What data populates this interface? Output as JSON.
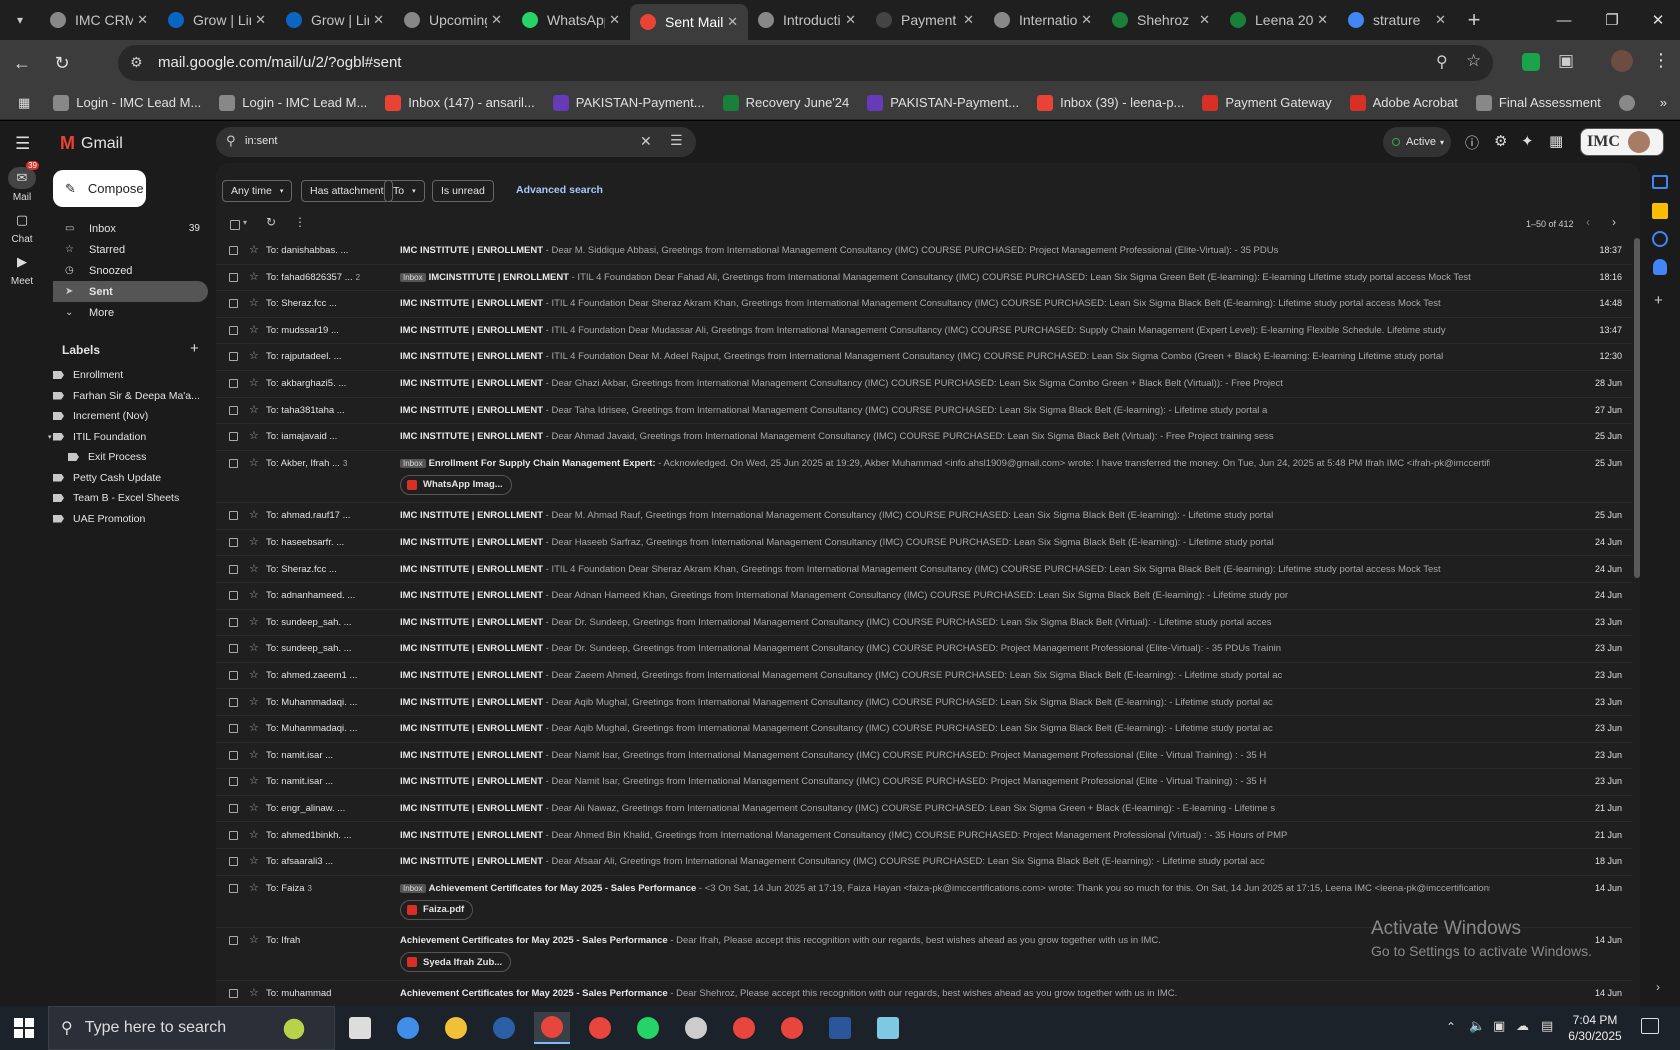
{
  "browser": {
    "tabs": [
      {
        "title": "IMC CRM",
        "favicon_color": "#888888"
      },
      {
        "title": "Grow | LinkedIn",
        "favicon_color": "#0a66c2"
      },
      {
        "title": "Grow | LinkedIn",
        "favicon_color": "#0a66c2"
      },
      {
        "title": "Upcoming",
        "favicon_color": "#888888"
      },
      {
        "title": "WhatsApp",
        "favicon_color": "#25d366"
      },
      {
        "title": "Sent Mail",
        "favicon_color": "#ea4335"
      },
      {
        "title": "Introduction",
        "favicon_color": "#888888"
      },
      {
        "title": "Payment",
        "favicon_color": "#444444"
      },
      {
        "title": "International",
        "favicon_color": "#888888"
      },
      {
        "title": "Shehroz",
        "favicon_color": "#188038"
      },
      {
        "title": "Leena 20",
        "favicon_color": "#188038"
      },
      {
        "title": "strature",
        "favicon_color": "#4285f4"
      }
    ],
    "active_tab": 5,
    "url": "mail.google.com/mail/u/2/?ogbl#sent",
    "bookmarks": [
      {
        "label": "Login - IMC Lead M...",
        "color": "#888888"
      },
      {
        "label": "Login - IMC Lead M...",
        "color": "#888888"
      },
      {
        "label": "Inbox (147) - ansaril...",
        "color": "#ea4335"
      },
      {
        "label": "PAKISTAN-Payment...",
        "color": "#673ab7"
      },
      {
        "label": "Recovery June'24",
        "color": "#188038"
      },
      {
        "label": "PAKISTAN-Payment...",
        "color": "#673ab7"
      },
      {
        "label": "Inbox (39) - leena-p...",
        "color": "#ea4335"
      },
      {
        "label": "Payment Gateway",
        "color": "#d93025"
      },
      {
        "label": "Adobe Acrobat",
        "color": "#d93025"
      },
      {
        "label": "Final Assessment",
        "color": "#888888"
      }
    ]
  },
  "gmail": {
    "logo": "Gmail",
    "rail": [
      {
        "label": "Mail",
        "badge": "39",
        "icon": "mail-icon"
      },
      {
        "label": "Chat",
        "icon": "chat-icon"
      },
      {
        "label": "Meet",
        "icon": "video-icon"
      }
    ],
    "compose": "Compose",
    "nav": [
      {
        "label": "Inbox",
        "count": "39",
        "icon": "inbox-icon"
      },
      {
        "label": "Starred",
        "count": "",
        "icon": "star-icon"
      },
      {
        "label": "Snoozed",
        "count": "",
        "icon": "clock-icon"
      },
      {
        "label": "Sent",
        "count": "",
        "icon": "send-icon"
      },
      {
        "label": "More",
        "count": "",
        "icon": "chevron-down-icon"
      }
    ],
    "active_nav": 3,
    "labels_heading": "Labels",
    "labels": [
      {
        "name": "Enrollment",
        "indent": false
      },
      {
        "name": "Farhan Sir & Deepa Ma'a...",
        "indent": false
      },
      {
        "name": "Increment (Nov)",
        "indent": false
      },
      {
        "name": "ITIL Foundation",
        "indent": false,
        "expanded": true
      },
      {
        "name": "Exit Process",
        "indent": true
      },
      {
        "name": "Petty Cash Update",
        "indent": false
      },
      {
        "name": "Team B - Excel Sheets",
        "indent": false
      },
      {
        "name": "UAE Promotion",
        "indent": false
      }
    ],
    "search_value": "in:sent",
    "status": "Active",
    "brand": "IMC",
    "filters": [
      "Any time",
      "Has attachment",
      "To",
      "Is unread"
    ],
    "advanced_search": "Advanced search",
    "pagination": "1–50 of 412",
    "emails": [
      {
        "to": "To: danishabbas. ...",
        "count": "",
        "inbox": false,
        "subject": "IMC INSTITUTE | ENROLLMENT",
        "snippet": " - Dear M. Siddique Abbasi, Greetings from International Management Consultancy (IMC) COURSE PURCHASED: Project Management Professional (Elite-Virtual): - 35 PDUs",
        "date": "18:37",
        "attachment": ""
      },
      {
        "to": "To: fahad6826357 ...",
        "count": "2",
        "inbox": true,
        "subject": "IMCINSTITUTE | ENROLLMENT",
        "snippet": " - ITIL 4 Foundation Dear Fahad Ali, Greetings from International Management Consultancy (IMC) COURSE PURCHASED: Lean Six Sigma Green Belt (E-learning): E-learning Lifetime study portal access Mock Test",
        "date": "18:16",
        "attachment": ""
      },
      {
        "to": "To: Sheraz.fcc ...",
        "count": "",
        "inbox": false,
        "subject": "IMC INSTITUTE | ENROLLMENT",
        "snippet": " - ITIL 4 Foundation Dear Sheraz Akram Khan, Greetings from International Management Consultancy (IMC) COURSE PURCHASED: Lean Six Sigma Black Belt (E-learning): Lifetime study portal access Mock Test",
        "date": "14:48",
        "attachment": ""
      },
      {
        "to": "To: mudssar19 ...",
        "count": "",
        "inbox": false,
        "subject": "IMC INSTITUTE | ENROLLMENT",
        "snippet": " - ITIL 4 Foundation Dear Mudassar Ali, Greetings from International Management Consultancy (IMC) COURSE PURCHASED: Supply Chain Management (Expert Level): E-learning Flexible Schedule. Lifetime study",
        "date": "13:47",
        "attachment": ""
      },
      {
        "to": "To: rajputadeel. ...",
        "count": "",
        "inbox": false,
        "subject": "IMC INSTITUTE | ENROLLMENT",
        "snippet": " - ITIL 4 Foundation Dear M. Adeel Rajput, Greetings from International Management Consultancy (IMC) COURSE PURCHASED: Lean Six Sigma Combo (Green + Black) E-learning: E-learning Lifetime study portal",
        "date": "12:30",
        "attachment": ""
      },
      {
        "to": "To: akbarghazi5. ...",
        "count": "",
        "inbox": false,
        "subject": "IMC INSTITUTE | ENROLLMENT",
        "snippet": " - Dear Ghazi Akbar, Greetings from International Management Consultancy (IMC) COURSE PURCHASED: Lean Six Sigma Combo Green + Black Belt (Virtual)): - Free Project",
        "date": "28 Jun",
        "attachment": ""
      },
      {
        "to": "To: taha381taha ...",
        "count": "",
        "inbox": false,
        "subject": "IMC INSTITUTE | ENROLLMENT",
        "snippet": " - Dear Taha Idrisee, Greetings from International Management Consultancy (IMC) COURSE PURCHASED: Lean Six Sigma Black Belt (E-learning): - Lifetime study portal a",
        "date": "27 Jun",
        "attachment": ""
      },
      {
        "to": "To: iamajavaid ...",
        "count": "",
        "inbox": false,
        "subject": "IMC INSTITUTE | ENROLLMENT",
        "snippet": " - Dear Ahmad Javaid, Greetings from International Management Consultancy (IMC) COURSE PURCHASED: Lean Six Sigma Black Belt (Virtual): - Free Project training sess",
        "date": "25 Jun",
        "attachment": ""
      },
      {
        "to": "To: Akber, Ifrah ...",
        "count": "3",
        "inbox": true,
        "subject": "Enrollment For Supply Chain Management Expert:",
        "snippet": " - Acknowledged. On Wed, 25 Jun 2025 at 19:29, Akber Muhammad <info.ahsl1909@gmail.com> wrote: I have transferred the money. On Tue, Jun 24, 2025 at 5:48 PM Ifrah IMC <ifrah-pk@imccertifications.",
        "date": "25 Jun",
        "attachment": "WhatsApp Imag..."
      },
      {
        "to": "To: ahmad.rauf17 ...",
        "count": "",
        "inbox": false,
        "subject": "IMC INSTITUTE | ENROLLMENT",
        "snippet": " - Dear M. Ahmad Rauf, Greetings from International Management Consultancy (IMC) COURSE PURCHASED: Lean Six Sigma Black Belt (E-learning): - Lifetime study portal",
        "date": "25 Jun",
        "attachment": ""
      },
      {
        "to": "To: haseebsarfr. ...",
        "count": "",
        "inbox": false,
        "subject": "IMC INSTITUTE | ENROLLMENT",
        "snippet": " - Dear Haseeb Sarfraz, Greetings from International Management Consultancy (IMC) COURSE PURCHASED: Lean Six Sigma Black Belt (E-learning): - Lifetime study portal",
        "date": "24 Jun",
        "attachment": ""
      },
      {
        "to": "To: Sheraz.fcc ...",
        "count": "",
        "inbox": false,
        "subject": "IMC INSTITUTE | ENROLLMENT",
        "snippet": " - ITIL 4 Foundation Dear Sheraz Akram Khan, Greetings from International Management Consultancy (IMC) COURSE PURCHASED: Lean Six Sigma Black Belt (E-learning): Lifetime study portal access Mock Test",
        "date": "24 Jun",
        "attachment": ""
      },
      {
        "to": "To: adnanhameed. ...",
        "count": "",
        "inbox": false,
        "subject": "IMC INSTITUTE | ENROLLMENT",
        "snippet": " - Dear Adnan Hameed Khan, Greetings from International Management Consultancy (IMC) COURSE PURCHASED: Lean Six Sigma Black Belt (E-learning): - Lifetime study por",
        "date": "24 Jun",
        "attachment": ""
      },
      {
        "to": "To: sundeep_sah. ...",
        "count": "",
        "inbox": false,
        "subject": "IMC INSTITUTE | ENROLLMENT",
        "snippet": " - Dear Dr. Sundeep, Greetings from International Management Consultancy (IMC) COURSE PURCHASED: Lean Six Sigma Black Belt (Virtual): - Lifetime study portal acces",
        "date": "23 Jun",
        "attachment": ""
      },
      {
        "to": "To: sundeep_sah. ...",
        "count": "",
        "inbox": false,
        "subject": "IMC INSTITUTE | ENROLLMENT",
        "snippet": " - Dear Dr. Sundeep, Greetings from International Management Consultancy (IMC) COURSE PURCHASED: Project Management Professional (Elite-Virtual): - 35 PDUs Trainin",
        "date": "23 Jun",
        "attachment": ""
      },
      {
        "to": "To: ahmed.zaeem1 ...",
        "count": "",
        "inbox": false,
        "subject": "IMC INSTITUTE | ENROLLMENT",
        "snippet": " - Dear Zaeem Ahmed, Greetings from International Management Consultancy (IMC) COURSE PURCHASED: Lean Six Sigma Black Belt (E-learning): - Lifetime study portal ac",
        "date": "23 Jun",
        "attachment": ""
      },
      {
        "to": "To: Muhammadaqi. ...",
        "count": "",
        "inbox": false,
        "subject": "IMC INSTITUTE | ENROLLMENT",
        "snippet": " - Dear Aqib Mughal, Greetings from International Management Consultancy (IMC) COURSE PURCHASED: Lean Six Sigma Black Belt (E-learning): - Lifetime study portal ac",
        "date": "23 Jun",
        "attachment": ""
      },
      {
        "to": "To: Muhammadaqi. ...",
        "count": "",
        "inbox": false,
        "subject": "IMC INSTITUTE | ENROLLMENT",
        "snippet": " - Dear Aqib Mughal, Greetings from International Management Consultancy (IMC) COURSE PURCHASED: Lean Six Sigma Black Belt (E-learning): - Lifetime study portal ac",
        "date": "23 Jun",
        "attachment": ""
      },
      {
        "to": "To: namit.isar ...",
        "count": "",
        "inbox": false,
        "subject": "IMC INSTITUTE | ENROLLMENT",
        "snippet": " - Dear Namit Isar, Greetings from International Management Consultancy (IMC) COURSE PURCHASED: Project Management Professional (Elite - Virtual Training) : - 35 H",
        "date": "23 Jun",
        "attachment": ""
      },
      {
        "to": "To: namit.isar ...",
        "count": "",
        "inbox": false,
        "subject": "IMC INSTITUTE | ENROLLMENT",
        "snippet": " - Dear Namit Isar, Greetings from International Management Consultancy (IMC) COURSE PURCHASED: Project Management Professional (Elite - Virtual Training) : - 35 H",
        "date": "23 Jun",
        "attachment": ""
      },
      {
        "to": "To: engr_alinaw. ...",
        "count": "",
        "inbox": false,
        "subject": "IMC INSTITUTE | ENROLLMENT",
        "snippet": " - Dear Ali Nawaz, Greetings from International Management Consultancy (IMC) COURSE PURCHASED: Lean Six Sigma Green + Black (E-learning): - E-learning - Lifetime s",
        "date": "21 Jun",
        "attachment": ""
      },
      {
        "to": "To: ahmed1binkh. ...",
        "count": "",
        "inbox": false,
        "subject": "IMC INSTITUTE | ENROLLMENT",
        "snippet": " - Dear Ahmed Bin Khalid, Greetings from International Management Consultancy (IMC) COURSE PURCHASED: Project Management Professional (Virtual) : - 35 Hours of PMP",
        "date": "21 Jun",
        "attachment": ""
      },
      {
        "to": "To: afsaarali3 ...",
        "count": "",
        "inbox": false,
        "subject": "IMC INSTITUTE | ENROLLMENT",
        "snippet": " - Dear Afsaar Ali, Greetings from International Management Consultancy (IMC) COURSE PURCHASED: Lean Six Sigma Black Belt (E-learning): - Lifetime study portal acc",
        "date": "18 Jun",
        "attachment": ""
      },
      {
        "to": "To: Faiza",
        "count": "3",
        "inbox": true,
        "subject": "Achievement Certificates for May 2025 - Sales Performance",
        "snippet": " - <3 On Sat, 14 Jun 2025 at 17:19, Faiza Hayan <faiza-pk@imccertifications.com> wrote: Thank you so much for this. On Sat, 14 Jun 2025 at 17:15, Leena IMC <leena-pk@imccertifications.com>",
        "date": "14 Jun",
        "attachment": "Faiza.pdf"
      },
      {
        "to": "To: Ifrah",
        "count": "",
        "inbox": false,
        "subject": "Achievement Certificates for May 2025 - Sales Performance",
        "snippet": " - Dear Ifrah, Please accept this recognition with our regards, best wishes ahead as you grow together with us in IMC.",
        "date": "14 Jun",
        "attachment": "Syeda Ifrah Zub..."
      },
      {
        "to": "To: muhammad",
        "count": "",
        "inbox": false,
        "subject": "Achievement Certificates for May 2025 - Sales Performance",
        "snippet": " - Dear Shehroz, Please accept this recognition with our regards, best wishes ahead as you grow together with us in IMC.",
        "date": "14 Jun",
        "attachment": ""
      }
    ],
    "inbox_chip": "Inbox"
  },
  "watermark": {
    "line1": "Activate Windows",
    "line2": "Go to Settings to activate Windows."
  },
  "taskbar": {
    "search_placeholder": "Type here to search",
    "time": "7:04 PM",
    "date": "6/30/2025",
    "apps": [
      "task-view",
      "copilot",
      "file-explorer",
      "app",
      "chrome",
      "chrome",
      "whatsapp",
      "clock",
      "chrome",
      "chrome",
      "word",
      "notepad"
    ]
  }
}
